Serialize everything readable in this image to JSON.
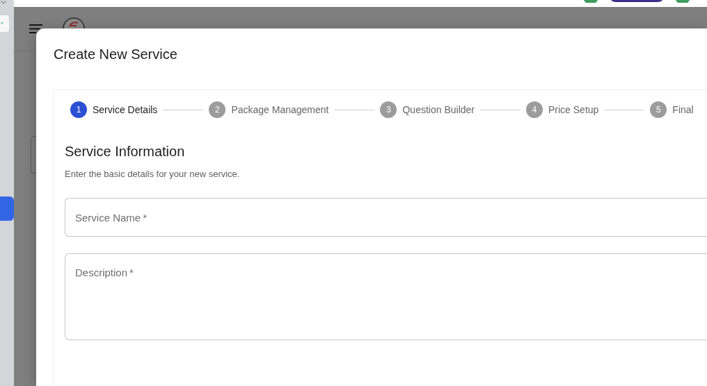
{
  "dialog": {
    "title": "Create New Service",
    "steps": [
      {
        "number": "1",
        "label": "Service Details",
        "selected": true
      },
      {
        "number": "2",
        "label": "Package Management",
        "selected": false
      },
      {
        "number": "3",
        "label": "Question Builder",
        "selected": false
      },
      {
        "number": "4",
        "label": "Price Setup",
        "selected": false
      },
      {
        "number": "5",
        "label": "Final",
        "selected": false
      }
    ],
    "section": {
      "title": "Service Information",
      "description": "Enter the basic details for your new service."
    },
    "fields": [
      {
        "kind": "text",
        "placeholder": "Service Name *"
      },
      {
        "kind": "textarea",
        "placeholder": "Description *"
      }
    ]
  }
}
